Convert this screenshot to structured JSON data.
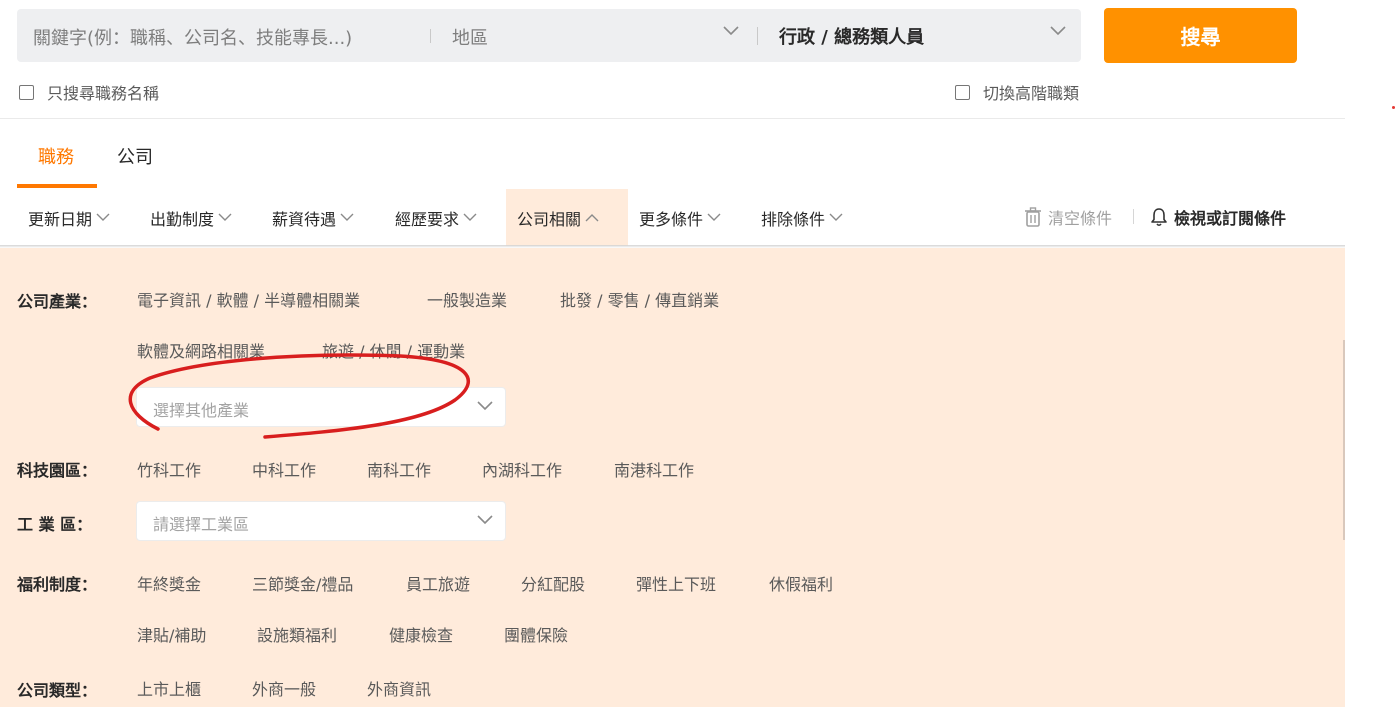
{
  "search": {
    "keyword_placeholder": "關鍵字(例：職稱、公司名、技能專長...)",
    "area_placeholder": "地區",
    "category_value": "行政 / 總務類人員",
    "button_label": "搜尋",
    "only_title_label": "只搜尋職務名稱",
    "advanced_label": "切換高階職類"
  },
  "tabs": [
    {
      "label": "職務",
      "active": true
    },
    {
      "label": "公司",
      "active": false
    }
  ],
  "filters": [
    {
      "label": "更新日期"
    },
    {
      "label": "出勤制度"
    },
    {
      "label": "薪資待遇"
    },
    {
      "label": "經歷要求"
    },
    {
      "label": "公司相關",
      "active": true
    },
    {
      "label": "更多條件"
    },
    {
      "label": "排除條件"
    }
  ],
  "actions": {
    "clear_label": "清空條件",
    "subscribe_label": "檢視或訂閱條件"
  },
  "panel": {
    "industry": {
      "label": "公司產業：",
      "options": [
        "電子資訊 / 軟體 / 半導體相關業",
        "一般製造業",
        "批發 / 零售 / 傳直銷業",
        "軟體及網路相關業",
        "旅遊 / 休閒 / 運動業"
      ],
      "select_placeholder": "選擇其他產業"
    },
    "science_park": {
      "label": "科技園區：",
      "options": [
        "竹科工作",
        "中科工作",
        "南科工作",
        "內湖科工作",
        "南港科工作"
      ]
    },
    "industrial_zone": {
      "label": "工 業 區：",
      "select_placeholder": "請選擇工業區"
    },
    "benefits": {
      "label": "福利制度：",
      "options": [
        "年終獎金",
        "三節獎金/禮品",
        "員工旅遊",
        "分紅配股",
        "彈性上下班",
        "休假福利",
        "津貼/補助",
        "設施類福利",
        "健康檢查",
        "團體保險"
      ]
    },
    "company_type": {
      "label": "公司類型：",
      "options": [
        "上市上櫃",
        "外商一般",
        "外商資訊"
      ]
    }
  },
  "colors": {
    "accent": "#ff9100",
    "tab_active": "#ff7800",
    "panel_bg": "#ffebdb",
    "annotation": "#d81e1e"
  }
}
